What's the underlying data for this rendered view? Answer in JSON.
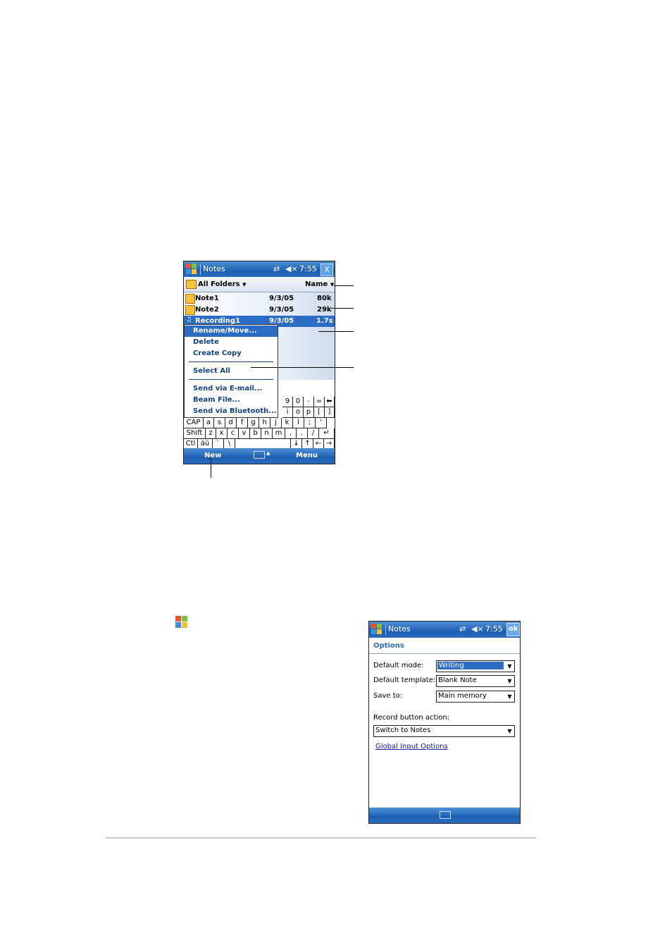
{
  "notes_list_screen": {
    "title": "Notes",
    "clock": "7:55",
    "close_label": "X",
    "status_icons": [
      "connectivity-icon",
      "speaker-muted-icon"
    ],
    "folder_filter": "All Folders",
    "sort_by": "Name",
    "files": [
      {
        "name": "Note1",
        "date": "9/3/05",
        "size": "80k",
        "type": "note",
        "selected": false
      },
      {
        "name": "Note2",
        "date": "9/3/05",
        "size": "29k",
        "type": "note",
        "selected": false
      },
      {
        "name": "Recording1",
        "date": "9/3/05",
        "size": "1.7s",
        "type": "recording",
        "selected": true
      }
    ],
    "context_menu": {
      "items": [
        "Rename/Move...",
        "Delete",
        "Create Copy",
        "Select All",
        "Send via E-mail...",
        "Beam File...",
        "Send via Bluetooth..."
      ],
      "highlighted": "Rename/Move..."
    },
    "keyboard": {
      "row1_visible": [
        "9",
        "0",
        "-",
        "="
      ],
      "row2_visible": [
        "i",
        "o",
        "p",
        "[",
        "]"
      ],
      "row3": [
        "CAP",
        "a",
        "s",
        "d",
        "f",
        "g",
        "h",
        "j",
        "k",
        "l",
        ";",
        "'"
      ],
      "row4": [
        "Shift",
        "z",
        "x",
        "c",
        "v",
        "b",
        "n",
        "m",
        ",",
        ".",
        "/"
      ],
      "row5": [
        "Ctl",
        "áü",
        "`",
        "\\"
      ]
    },
    "toolbar": {
      "new_label": "New",
      "menu_label": "Menu"
    }
  },
  "options_screen": {
    "title": "Notes",
    "clock": "7:55",
    "ok_label": "ok",
    "heading": "Options",
    "default_mode_label": "Default mode:",
    "default_mode_value": "Writing",
    "default_template_label": "Default template:",
    "default_template_value": "Blank Note",
    "save_to_label": "Save to:",
    "save_to_value": "Main memory",
    "record_action_label": "Record button action:",
    "record_action_value": "Switch to Notes",
    "link_label": "Global Input Options"
  },
  "colors": {
    "titlebar": "#2a6cc0",
    "selection": "#2c6cc4",
    "menu_text": "#16417f",
    "folder_icon": "#f6c23c",
    "link": "#1a1aa6"
  }
}
